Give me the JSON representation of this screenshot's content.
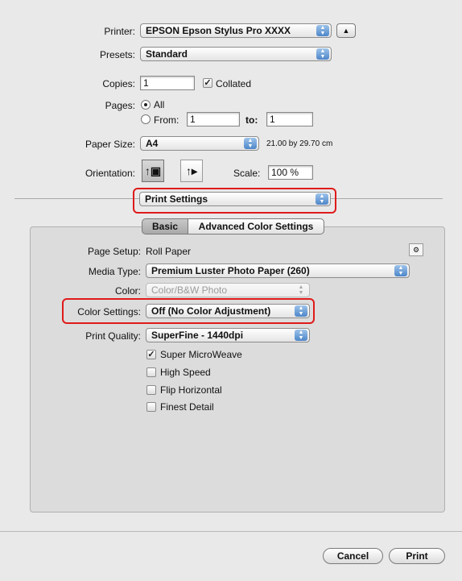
{
  "printer": {
    "label": "Printer:",
    "value": "EPSON Epson Stylus Pro XXXX"
  },
  "presets": {
    "label": "Presets:",
    "value": "Standard"
  },
  "copies": {
    "label": "Copies:",
    "value": "1",
    "collated_label": "Collated",
    "collated": true
  },
  "pages": {
    "label": "Pages:",
    "all_label": "All",
    "from_label": "From:",
    "from_value": "1",
    "to_label": "to:",
    "to_value": "1"
  },
  "paper_size": {
    "label": "Paper Size:",
    "value": "A4",
    "dimensions": "21.00 by 29.70 cm"
  },
  "orientation": {
    "label": "Orientation:"
  },
  "scale": {
    "label": "Scale:",
    "value": "100 %"
  },
  "panel_menu": {
    "value": "Print Settings"
  },
  "tabs": [
    {
      "label": "Basic"
    },
    {
      "label": "Advanced Color Settings"
    }
  ],
  "settings": {
    "page_setup": {
      "label": "Page Setup:",
      "value": "Roll Paper"
    },
    "media_type": {
      "label": "Media Type:",
      "value": "Premium Luster Photo Paper (260)"
    },
    "color": {
      "label": "Color:",
      "value": "Color/B&W Photo"
    },
    "color_settings": {
      "label": "Color Settings:",
      "value": "Off (No Color Adjustment)"
    },
    "print_quality": {
      "label": "Print Quality:",
      "value": "SuperFine - 1440dpi"
    },
    "options": [
      {
        "label": "Super MicroWeave",
        "checked": true
      },
      {
        "label": "High Speed",
        "checked": false
      },
      {
        "label": "Flip Horizontal",
        "checked": false
      },
      {
        "label": "Finest Detail",
        "checked": false
      }
    ]
  },
  "buttons": {
    "cancel": "Cancel",
    "print": "Print"
  },
  "colors": {
    "highlight": "#e01a1a",
    "popup_arrow": "#4d86c9"
  }
}
